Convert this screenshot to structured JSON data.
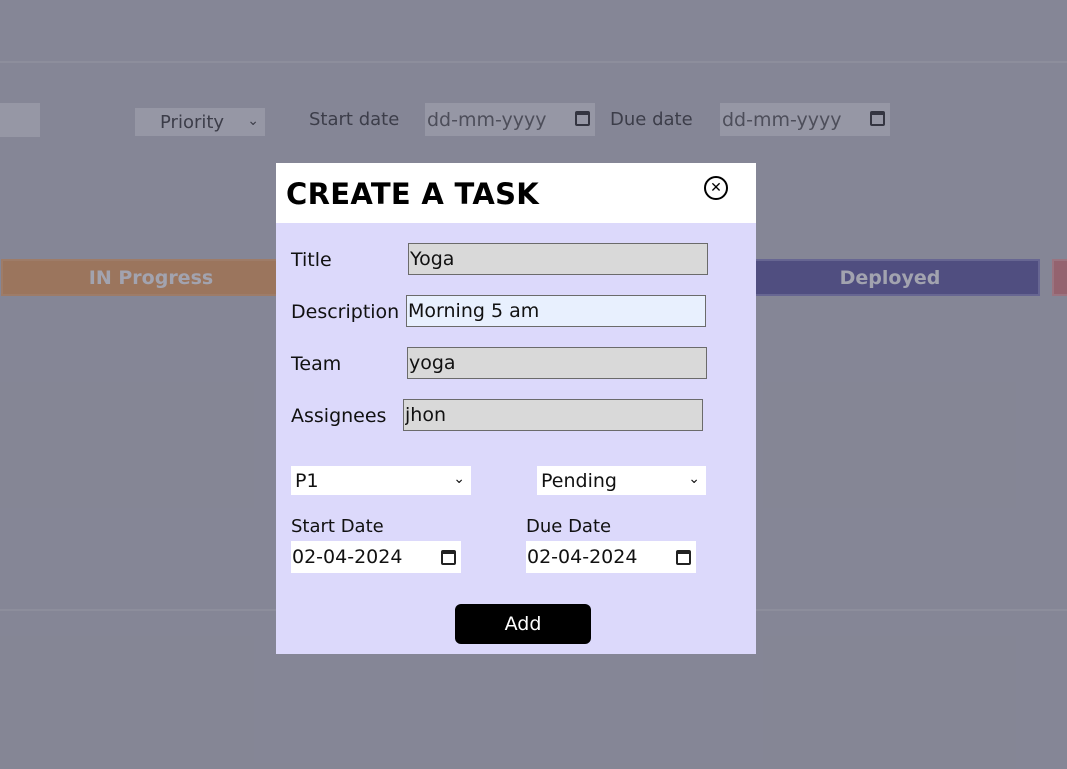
{
  "background": {
    "filters": {
      "priority": "Priority",
      "start_date_label": "Start date",
      "start_date_placeholder": "dd-mm-yyyy",
      "due_date_label": "Due date",
      "due_date_placeholder": "dd-mm-yyyy"
    },
    "columns": [
      "IN Progress",
      "Deployed"
    ]
  },
  "modal": {
    "title": "CREATE A TASK",
    "fields": {
      "title_label": "Title",
      "title_value": "Yoga",
      "description_label": "Description",
      "description_value": "Morning 5 am",
      "team_label": "Team",
      "team_value": "yoga",
      "assignees_label": "Assignees",
      "assignees_value": "jhon"
    },
    "priority_value": "P1",
    "status_value": "Pending",
    "start_date_label": "Start Date",
    "start_date_value": "02-04-2024",
    "due_date_label": "Due Date",
    "due_date_value": "02-04-2024",
    "add_label": "Add"
  }
}
